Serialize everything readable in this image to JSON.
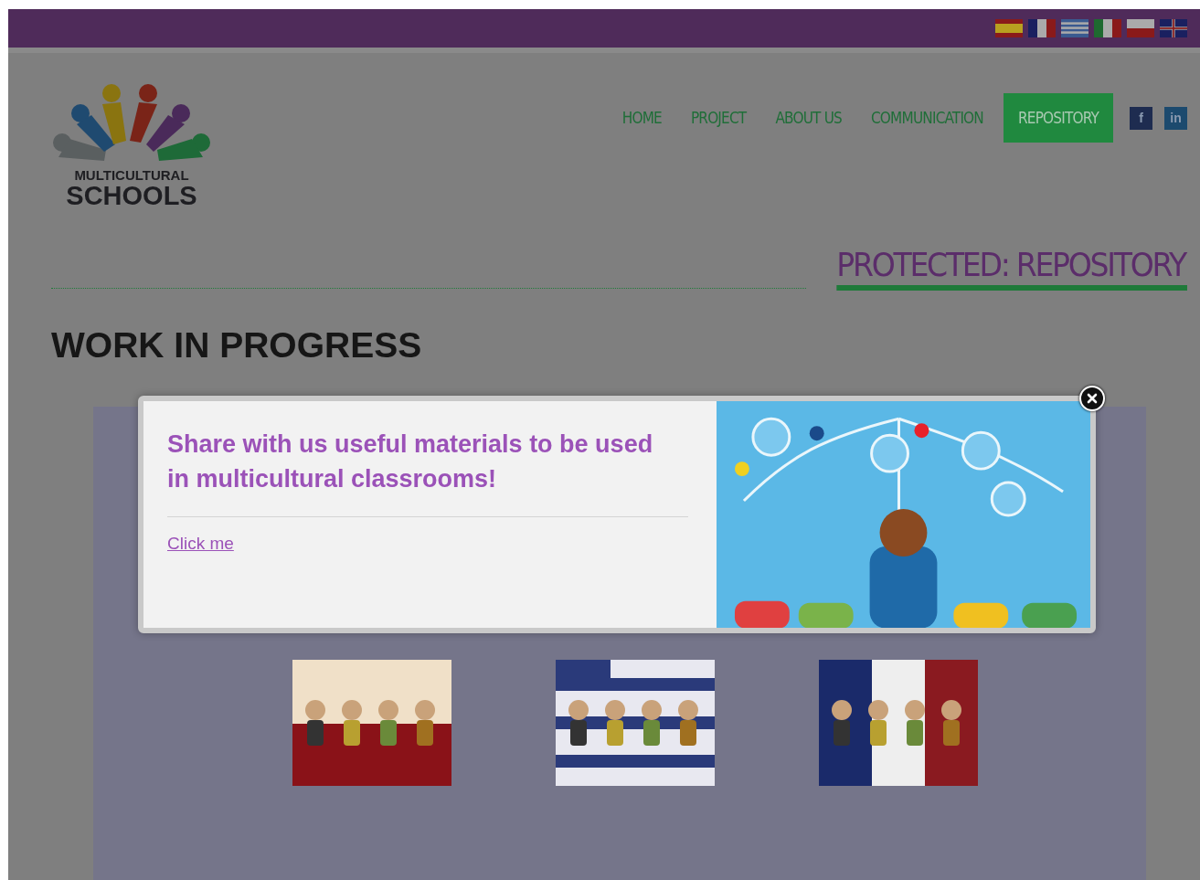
{
  "top_bar": {
    "languages": [
      {
        "kind": "es"
      },
      {
        "kind": "fr"
      },
      {
        "kind": "gr"
      },
      {
        "kind": "it"
      },
      {
        "kind": "pl"
      },
      {
        "kind": "uk"
      }
    ]
  },
  "header": {
    "logo": {
      "line_1": "MULTICULTURAL",
      "line_2": "SCHOOLS"
    },
    "nav": [
      {
        "label": "HOME",
        "selected": false
      },
      {
        "label": "PROJECT",
        "selected": false
      },
      {
        "label": "ABOUT US",
        "selected": false
      },
      {
        "label": "COMMUNICATION",
        "selected": false
      },
      {
        "label": "REPOSITORY",
        "selected": true
      }
    ],
    "social": [
      {
        "kind": "facebook",
        "label": "f"
      },
      {
        "kind": "linkedin",
        "label": "in"
      }
    ]
  },
  "page_title": "PROTECTED: REPOSITORY",
  "heading": "WORK IN PROGRESS",
  "popup": {
    "message": "Share with us useful materials to be used in multicultural classrooms!",
    "link": "Click me"
  }
}
